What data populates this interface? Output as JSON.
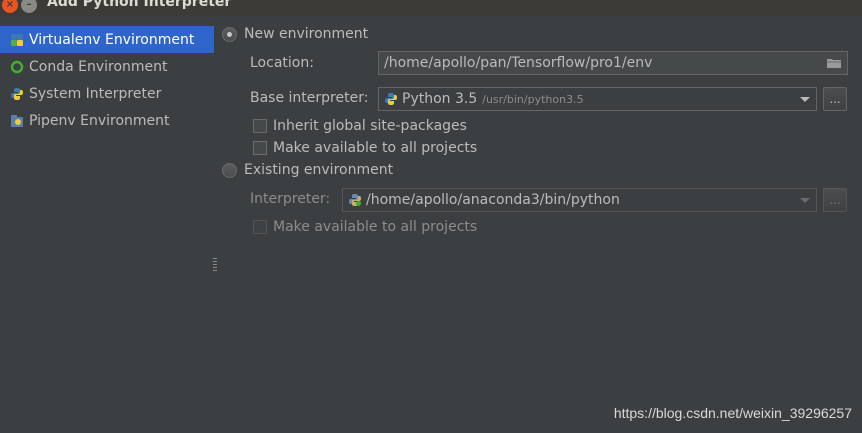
{
  "window": {
    "title": "Add Python Interpreter",
    "close_glyph": "×",
    "minimize_glyph": "–"
  },
  "env_list": {
    "items": [
      {
        "label": "Virtualenv Environment",
        "icon": "virtualenv-icon",
        "selected": true
      },
      {
        "label": "Conda Environment",
        "icon": "conda-icon",
        "selected": false
      },
      {
        "label": "System Interpreter",
        "icon": "python-icon",
        "selected": false
      },
      {
        "label": "Pipenv Environment",
        "icon": "pipenv-icon",
        "selected": false
      }
    ]
  },
  "new_env": {
    "radio_label": "New environment",
    "selected": true,
    "location_label": "Location:",
    "location_value": "/home/apollo/pan/Tensorflow/pro1/env",
    "base_label": "Base interpreter:",
    "base_name": "Python 3.5",
    "base_path": "/usr/bin/python3.5",
    "browse_label": "...",
    "inherit_label": "Inherit global site-packages",
    "inherit_checked": false,
    "make_available_label": "Make available to all projects",
    "make_available_checked": false
  },
  "existing_env": {
    "radio_label": "Existing environment",
    "selected": false,
    "interpreter_label": "Interpreter:",
    "interpreter_value": "/home/apollo/anaconda3/bin/python",
    "browse_label": "...",
    "make_available_label": "Make available to all projects",
    "make_available_checked": false
  },
  "watermark": "https://blog.csdn.net/weixin_39296257",
  "colors": {
    "background": "#3c3f41",
    "selection": "#2f65ca",
    "text": "#bbbbbb",
    "disabled_text": "#8c8c8c"
  }
}
